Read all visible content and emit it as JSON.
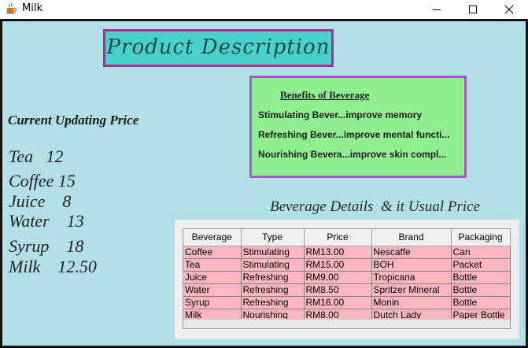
{
  "window": {
    "title": "Milk",
    "minimize_glyph": "—",
    "maximize_glyph": "☐",
    "close_glyph": "✕"
  },
  "heading": "Product Description",
  "benefits": {
    "title": "Benefits of Beverage",
    "lines": [
      "Stimulating Bever...improve memory",
      "Refreshing  Bever...improve mental functi...",
      "Nourishing Bevera...improve skin compl..."
    ]
  },
  "current_price": {
    "label": "Current  Updating Price",
    "items": [
      "Tea   12",
      "Coffee 15",
      "Juice    8",
      "Water    13",
      "Syrup    18",
      "Milk    12.50"
    ]
  },
  "details_title": "Beverage Details  & it Usual Price",
  "table": {
    "columns": [
      "Beverage",
      "Type",
      "Price",
      "Brand",
      "Packaging"
    ],
    "rows": [
      [
        "Coffee",
        "Stimulating",
        "RM13.00",
        "Nescaffe",
        "Can"
      ],
      [
        "Tea",
        "Stimulating",
        "RM15.00",
        "BOH",
        "Packet"
      ],
      [
        "Juice",
        "Refreshing",
        "RM9.00",
        "Tropicana",
        "Bottle"
      ],
      [
        "Water",
        "Refreshing",
        "RM8.50",
        "Spritzer Mineral",
        "Bottle"
      ],
      [
        "Syrup",
        "Refreshing",
        "RM16.00",
        "Monin",
        "Bottle"
      ],
      [
        "Milk",
        "Nourishing",
        "RM8.00",
        "Dutch Lady",
        "Paper Bottle"
      ]
    ]
  },
  "colors": {
    "background": "#b0e0e6",
    "heading_fill": "#48d1cc",
    "heading_border": "#b02b8a",
    "benefits_fill": "#90ee90",
    "benefits_border": "#a45ac8",
    "table_row": "#ffb6c1"
  },
  "icons": {
    "app_icon": "java-cup-icon"
  }
}
